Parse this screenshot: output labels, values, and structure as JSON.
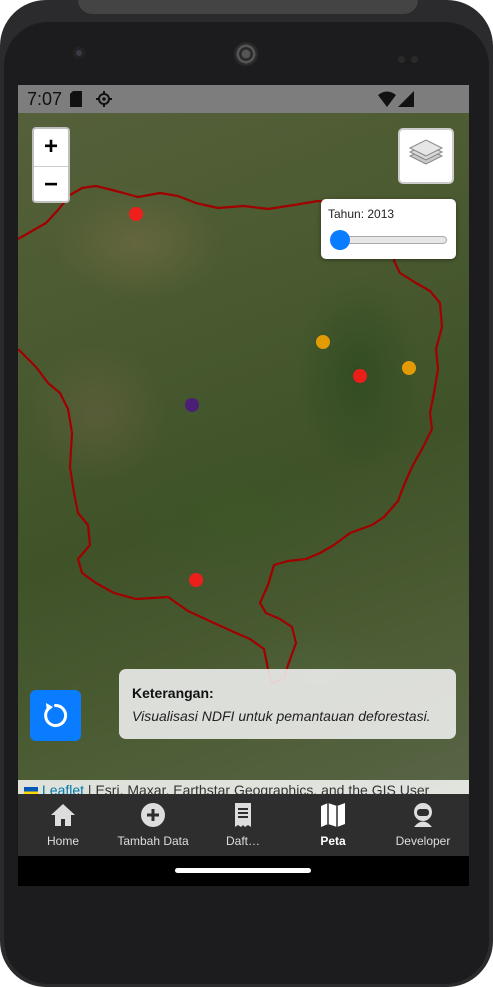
{
  "status_bar": {
    "time": "7:07"
  },
  "map": {
    "zoom_in_label": "+",
    "zoom_out_label": "−",
    "year_control": {
      "label": "Tahun: 2013",
      "year": 2013
    },
    "legend": {
      "title": "Keterangan:",
      "description": "Visualisasi NDFI untuk pemantauan deforestasi."
    },
    "attribution": {
      "link": "Leaflet",
      "text": " | Esri, Maxar, Earthstar Geographics, and the GIS User Community"
    },
    "marker_colors": {
      "red": "#ff1a1a",
      "orange": "#f5a300",
      "purple": "#4b1a7d"
    }
  },
  "tabs": [
    {
      "label": "Home",
      "icon": "home-icon"
    },
    {
      "label": "Tambah Data",
      "icon": "plus-circle-icon"
    },
    {
      "label": "Daft…",
      "icon": "receipt-icon"
    },
    {
      "label": "Peta",
      "icon": "map-icon",
      "active": true
    },
    {
      "label": "Developer",
      "icon": "astronaut-icon"
    }
  ],
  "colors": {
    "accent": "#0a7cff",
    "boundary": "#a00000",
    "tabbar": "#2e2e2e"
  }
}
